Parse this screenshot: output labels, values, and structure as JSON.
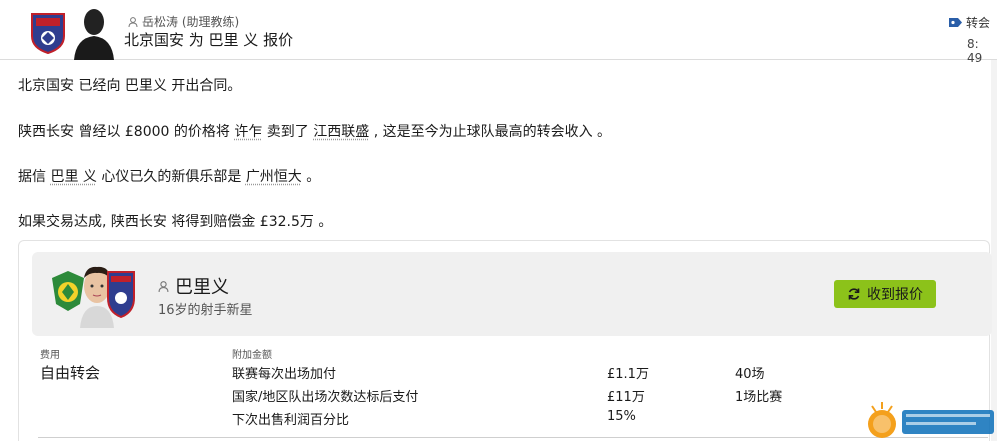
{
  "header": {
    "sender": "岳松涛 (助理教练)",
    "subject": "北京国安 为 巴里 义 报价",
    "tag_label": "转会",
    "time": "8: 49"
  },
  "messages": {
    "line1": "北京国安 已经向 巴里义 开出合同。",
    "line2_prefix": "陕西长安 曾经以 £8000 的价格将 ",
    "line2_player": "许乍",
    "line2_mid": " 卖到了 ",
    "line2_club": "江西联盛",
    "line2_suffix": " , 这是至今为止球队最高的转会收入 。",
    "line3_prefix": "据信 ",
    "line3_player": "巴里 义",
    "line3_mid": " 心仪已久的新俱乐部是 ",
    "line3_club": "广州恒大",
    "line3_suffix": " 。",
    "line4": "如果交易达成, 陕西长安 将得到赔偿金 £32.5万 。"
  },
  "player": {
    "name": "巴里义",
    "description": "16岁的射手新星",
    "offer_button": "收到报价"
  },
  "deal": {
    "fee_label": "费用",
    "fee_value": "自由转会",
    "bonus_label": "附加金额",
    "bonuses": [
      {
        "name": "联赛每次出场加付",
        "amount": "£1.1万",
        "condition": "40场"
      },
      {
        "name": "国家/地区队出场次数达标后支付",
        "amount": "£11万",
        "condition": "1场比赛"
      },
      {
        "name": "下次出售利润百分比",
        "amount": "15%",
        "condition": ""
      }
    ]
  },
  "colors": {
    "accent_green": "#8cc21a",
    "tag_blue": "#2a5ea8"
  },
  "icons": {
    "sender": "person-icon",
    "tag": "tag-icon",
    "button": "refresh-icon"
  }
}
